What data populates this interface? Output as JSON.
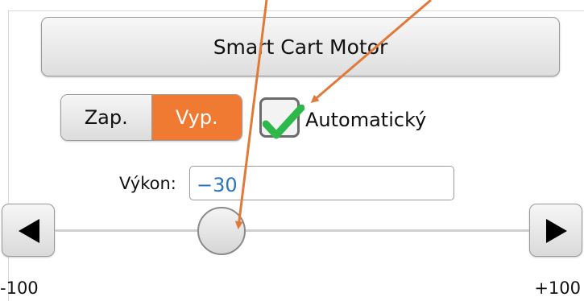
{
  "app": {
    "title": "Smart Cart Motor"
  },
  "power_toggle": {
    "on_label": "Zap.",
    "off_label": "Vyp.",
    "selected": "Vyp."
  },
  "automatic": {
    "label": "Automatický",
    "checked": true
  },
  "power": {
    "label": "Výkon:",
    "value": "−30",
    "min_label": "-100",
    "max_label": "+100",
    "min": -100,
    "max": 100,
    "slider_value": -30
  },
  "icons": {
    "decrease": "left-triangle-icon",
    "increase": "right-triangle-icon",
    "check": "check-icon"
  },
  "colors": {
    "accent": "#f07a32",
    "check": "#2db84a",
    "value_text": "#2a74c4",
    "annotation_arrow": "#e07a3a"
  }
}
